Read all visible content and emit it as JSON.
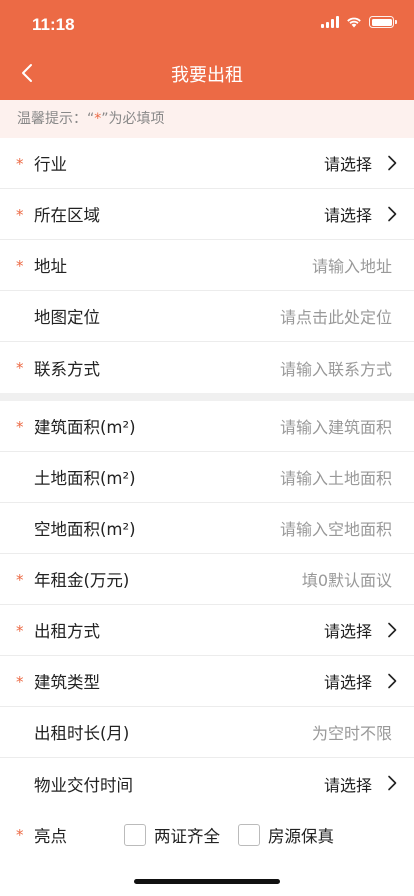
{
  "status": {
    "time": "11:18"
  },
  "nav": {
    "title": "我要出租"
  },
  "notice": {
    "prefix": "温馨提示：“",
    "star": "*",
    "suffix": "”为必填项"
  },
  "required_mark": "*",
  "form_group1": [
    {
      "label": "行业",
      "value": "请选择",
      "required": true,
      "type": "select"
    },
    {
      "label": "所在区域",
      "value": "请选择",
      "required": true,
      "type": "select"
    },
    {
      "label": "地址",
      "placeholder": "请输入地址",
      "required": true,
      "type": "input"
    },
    {
      "label": "地图定位",
      "placeholder": "请点击此处定位",
      "required": false,
      "type": "input"
    },
    {
      "label": "联系方式",
      "placeholder": "请输入联系方式",
      "required": true,
      "type": "input"
    }
  ],
  "form_group2": [
    {
      "label": "建筑面积(m²)",
      "placeholder": "请输入建筑面积",
      "required": true,
      "type": "input"
    },
    {
      "label": "土地面积(m²)",
      "placeholder": "请输入土地面积",
      "required": false,
      "type": "input"
    },
    {
      "label": "空地面积(m²)",
      "placeholder": "请输入空地面积",
      "required": false,
      "type": "input"
    },
    {
      "label": "年租金(万元)",
      "placeholder": "填0默认面议",
      "required": true,
      "type": "input"
    },
    {
      "label": "出租方式",
      "value": "请选择",
      "required": true,
      "type": "select"
    },
    {
      "label": "建筑类型",
      "value": "请选择",
      "required": true,
      "type": "select"
    },
    {
      "label": "出租时长(月)",
      "placeholder": "为空时不限",
      "required": false,
      "type": "input"
    },
    {
      "label": "物业交付时间",
      "value": "请选择",
      "required": false,
      "type": "select"
    }
  ],
  "highlights": {
    "label": "亮点",
    "required": true,
    "options": [
      "两证齐全",
      "房源保真"
    ]
  },
  "colors": {
    "accent": "#ec6a45",
    "notice_bg": "#fdf1ee"
  }
}
